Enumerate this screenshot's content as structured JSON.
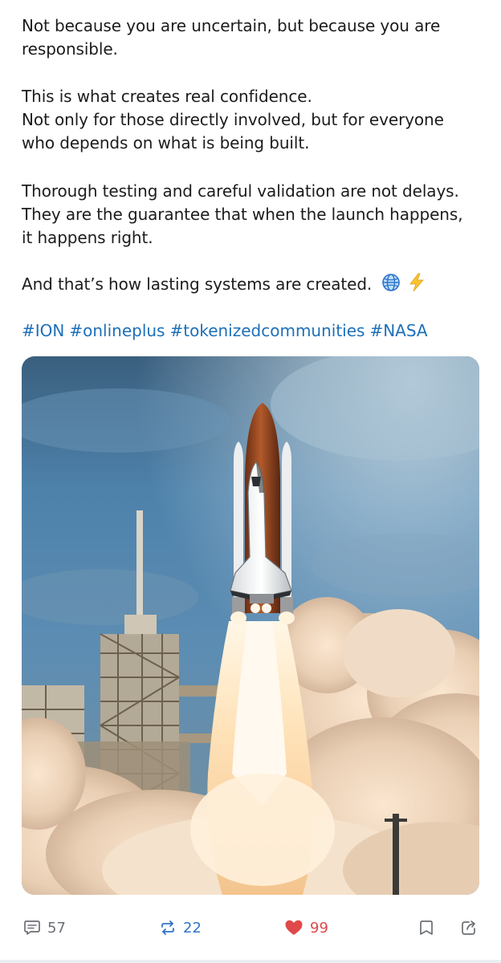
{
  "post": {
    "paragraphs": {
      "p1": [
        "Not because you are uncertain, but because you are",
        "responsible."
      ],
      "p2": [
        "This is what creates real confidence.",
        "Not only for those directly involved, but for everyone",
        "who depends on what is being built."
      ],
      "p3": [
        "Thorough testing and careful validation are not delays.",
        "They are the guarantee that when the launch happens,",
        "it happens right."
      ],
      "p4": "And that’s how lasting systems are created."
    },
    "emojis": [
      "globe-icon",
      "lightning-icon"
    ],
    "hashtags": [
      "#ION",
      "#onlineplus",
      "#tokenizedcommunities",
      "#NASA"
    ],
    "image": {
      "subject": "space-shuttle-launch"
    }
  },
  "actions": {
    "comments": "57",
    "reposts": "22",
    "likes": "99",
    "icons": {
      "comment": "comment-icon",
      "repost": "repost-icon",
      "like": "heart-icon",
      "bookmark": "bookmark-icon",
      "share": "share-icon"
    }
  },
  "colors": {
    "text": "#1c1c1c",
    "hashtag": "#1d6fb8",
    "repost": "#2f74c9",
    "like": "#e0484a",
    "muted": "#6b6f74"
  }
}
